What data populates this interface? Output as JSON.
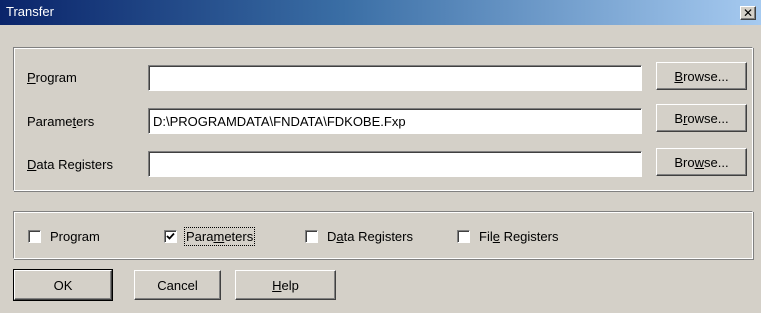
{
  "window": {
    "title": "Transfer",
    "close_glyph": "✕"
  },
  "files": {
    "rows": [
      {
        "key": "P",
        "label_pre": "",
        "label_key": "P",
        "label_post": "rogram",
        "value": ""
      },
      {
        "key": "t",
        "label_pre": "Parame",
        "label_key": "t",
        "label_post": "ers",
        "value": "D:\\PROGRAMDATA\\FNDATA\\FDKOBE.Fxp"
      },
      {
        "key": "D",
        "label_pre": "",
        "label_key": "D",
        "label_post": "ata Registers",
        "value": ""
      }
    ],
    "browse": [
      {
        "pre": "",
        "key": "B",
        "post": "rowse..."
      },
      {
        "pre": "B",
        "key": "r",
        "post": "owse..."
      },
      {
        "pre": "Bro",
        "key": "w",
        "post": "se..."
      }
    ]
  },
  "options": [
    {
      "pre": "Pro",
      "key": "g",
      "post": "ram",
      "checked": false
    },
    {
      "pre": "Para",
      "key": "m",
      "post": "eters",
      "checked": true
    },
    {
      "pre": "D",
      "key": "a",
      "post": "ta Registers",
      "checked": false
    },
    {
      "pre": "Fil",
      "key": "e",
      "post": " Registers",
      "checked": false
    }
  ],
  "buttons": {
    "ok": "OK",
    "cancel": "Cancel",
    "help_key": "H",
    "help_post": "elp"
  },
  "colors": {
    "titlebar_start": "#0a246a",
    "titlebar_end": "#a6caf0",
    "face": "#d4d0c8"
  }
}
